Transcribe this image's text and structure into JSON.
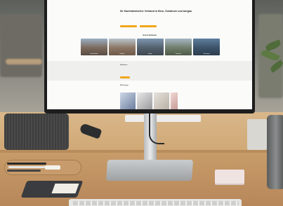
{
  "website": {
    "hero_title": "Ihr Kaufmännischer Verband in Bern, Solothurn und Aargau",
    "hero_text": "",
    "hero_buttons": [
      "",
      ""
    ],
    "cities_title": "Unsere Sektionen",
    "cities": [
      {
        "label": "Bern Mittelland"
      },
      {
        "label": "Solothurn"
      },
      {
        "label": "Aargau"
      },
      {
        "label": "Emmental"
      },
      {
        "label": "Oberaargau"
      }
    ],
    "band_title": "Sektionen",
    "band_text": "",
    "references_title": "Werbungen",
    "references_text": ""
  },
  "colors": {
    "accent": "#f2a71b",
    "desk": "#cfa774",
    "monitor_frame": "#1d1d1d"
  }
}
